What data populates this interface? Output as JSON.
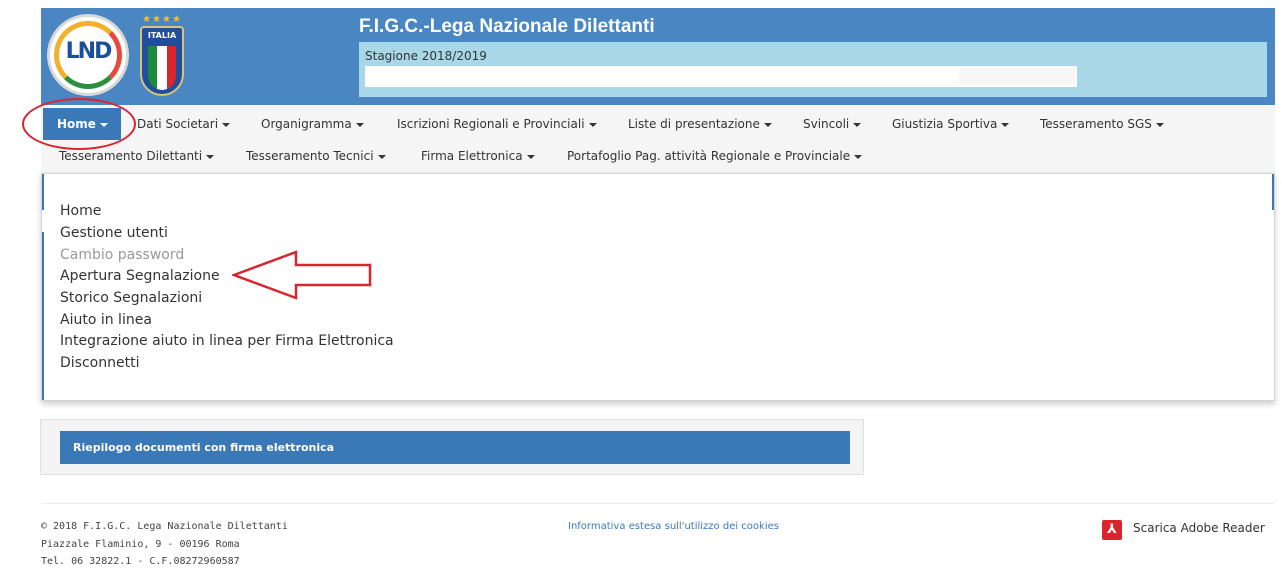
{
  "header": {
    "title": "F.I.G.C.-Lega Nazionale Dilettanti",
    "season": "Stagione 2018/2019",
    "logo_lnd_text": "LND",
    "logo_italia_text": "ITALIA",
    "brand_color": "#4a86c1"
  },
  "nav": {
    "items": [
      {
        "label": "Home",
        "active": true
      },
      {
        "label": "Dati Societari"
      },
      {
        "label": "Organigramma"
      },
      {
        "label": "Iscrizioni Regionali e Provinciali"
      },
      {
        "label": "Liste di presentazione"
      },
      {
        "label": "Svincoli"
      },
      {
        "label": "Giustizia Sportiva"
      },
      {
        "label": "Tesseramento SGS"
      },
      {
        "label": "Tesseramento Dilettanti"
      },
      {
        "label": "Tesseramento Tecnici"
      },
      {
        "label": "Firma Elettronica"
      },
      {
        "label": "Portafoglio Pag. attività Regionale e Provinciale"
      }
    ]
  },
  "home_menu": {
    "items": [
      {
        "label": "Home"
      },
      {
        "label": "Gestione utenti"
      },
      {
        "label": "Cambio password",
        "disabled": true
      },
      {
        "label": "Apertura Segnalazione"
      },
      {
        "label": "Storico Segnalazioni"
      },
      {
        "label": "Aiuto in linea"
      },
      {
        "label": "Integrazione aiuto in linea per Firma Elettronica"
      },
      {
        "label": "Disconnetti"
      }
    ]
  },
  "riepilogo": {
    "label": "Riepilogo documenti con firma elettronica"
  },
  "footer": {
    "copyright": "© 2018 F.I.G.C. Lega Nazionale Dilettanti",
    "address": "Piazzale Flaminio, 9 - 00196 Roma",
    "contacts": "Tel. 06 32822.1 - C.F.08272960587",
    "cookies_link": "Informativa estesa sull'utilizzo dei cookies",
    "adobe_link": "Scarica Adobe Reader",
    "adobe_icon_glyph": "⅄"
  },
  "annotation_color": "#d9262e"
}
